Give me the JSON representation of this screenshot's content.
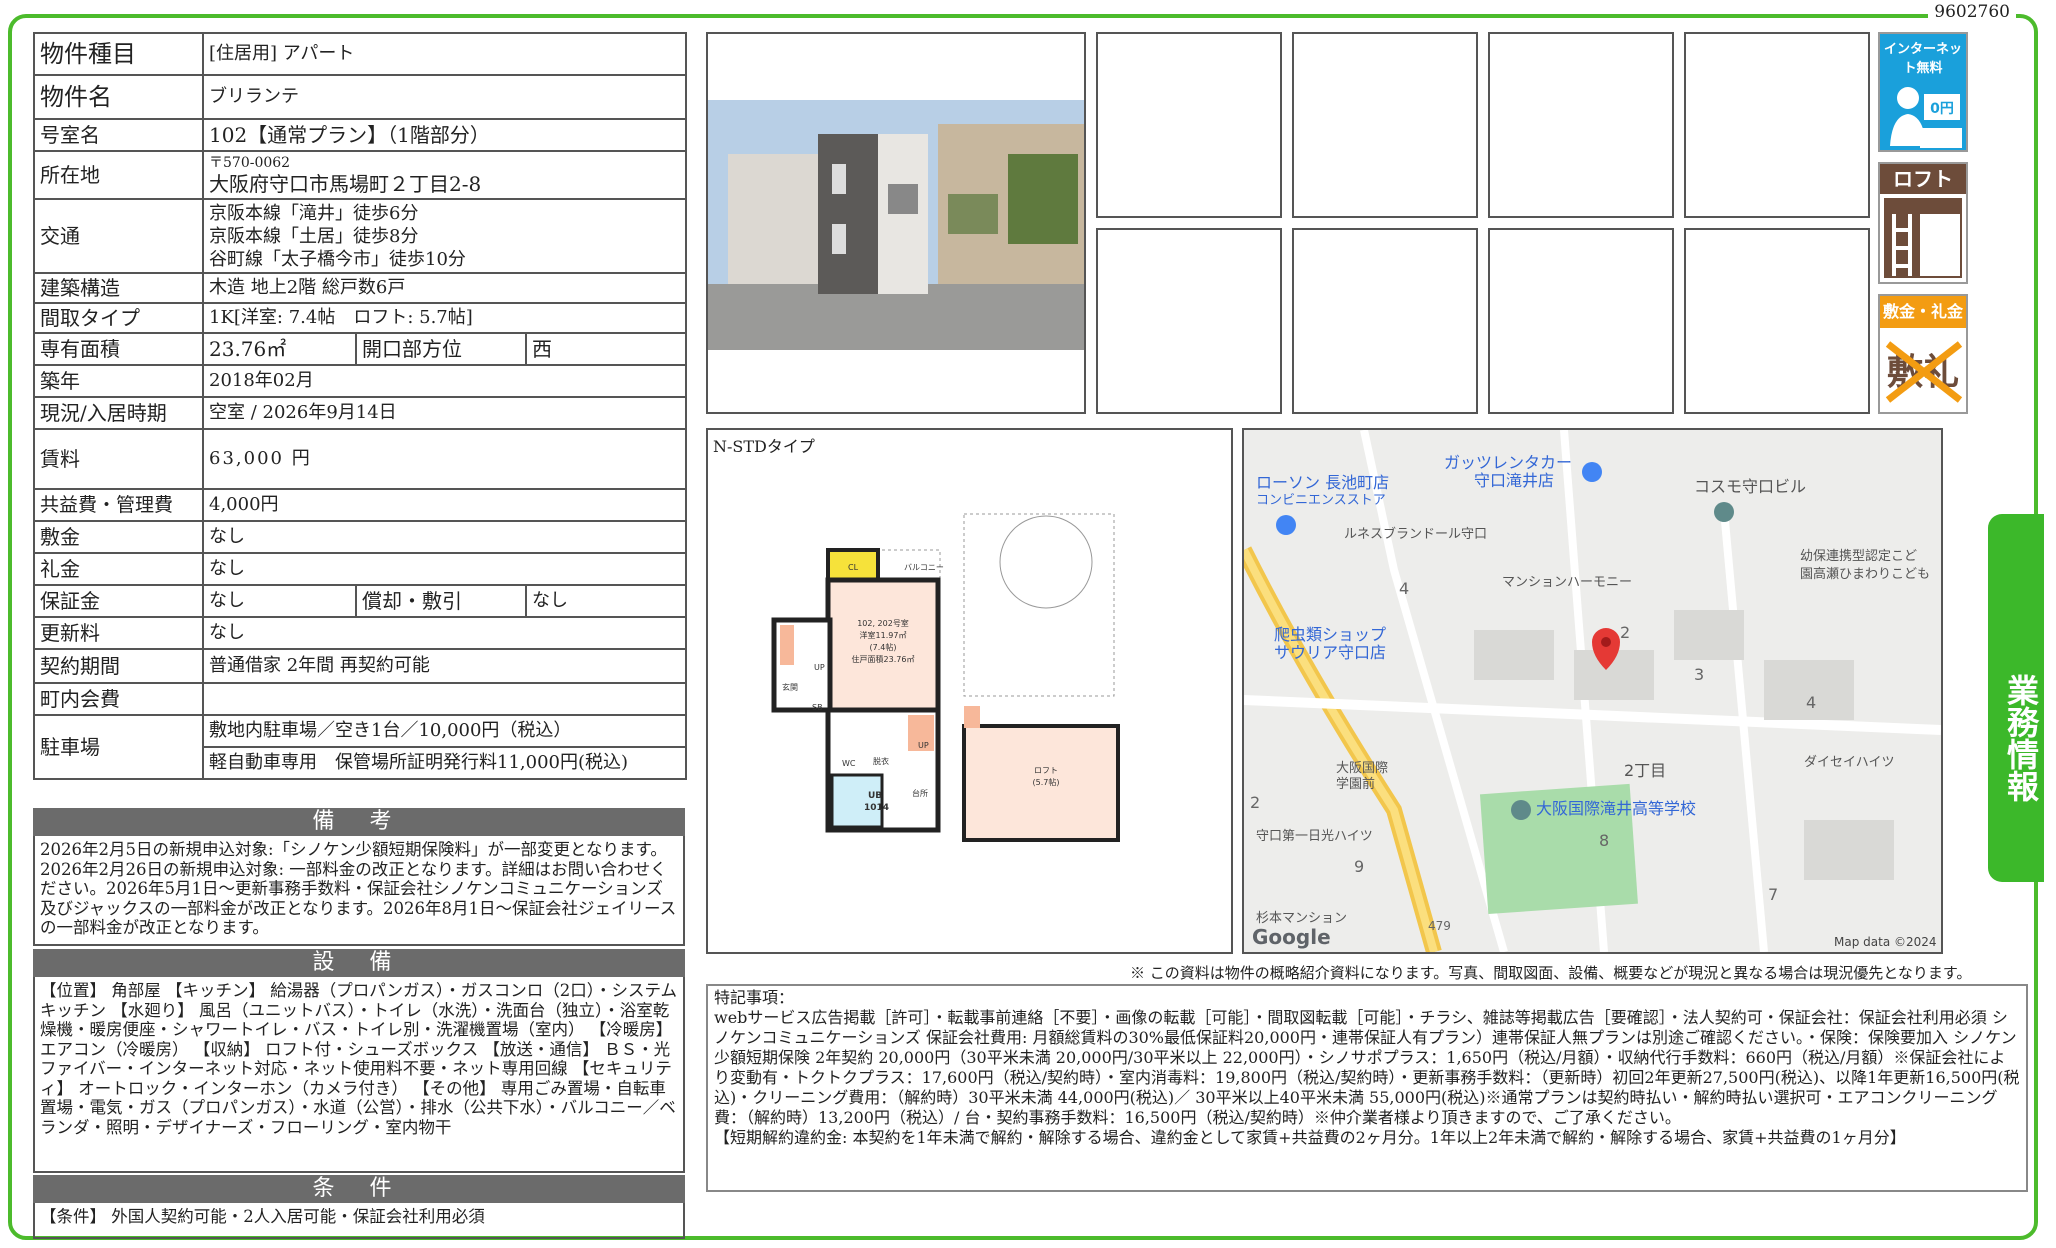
{
  "doc_id": "9602760",
  "property": {
    "type_label": "物件種目",
    "type_value": "[住居用] アパート",
    "name_label": "物件名",
    "name_value": "ブリランテ",
    "room_label": "号室名",
    "room_value": "102【通常プラン】（1階部分）",
    "address_label": "所在地",
    "postal": "〒570-0062",
    "address": "大阪府守口市馬場町２丁目2-8",
    "access_label": "交通",
    "access": [
      "京阪本線「滝井」徒歩6分",
      "京阪本線「土居」徒歩8分",
      "谷町線「太子橋今市」徒歩10分"
    ],
    "structure_label": "建築構造",
    "structure_value": "木造 地上2階 総戸数6戸",
    "layout_label": "間取タイプ",
    "layout_value": "1K[洋室: 7.4帖　ロフト: 5.7帖]",
    "area_label": "専有面積",
    "area_value": "23.76㎡",
    "direction_label": "開口部方位",
    "direction_value": "西",
    "built_label": "築年",
    "built_value": "2018年02月",
    "status_label": "現況/入居時期",
    "status_value": "空室 / 2026年9月14日",
    "rent_label": "賃料",
    "rent_value": "63,000 円",
    "fee_label": "共益費・管理費",
    "fee_value": "4,000円",
    "deposit_label": "敷金",
    "deposit_value": "なし",
    "keymoney_label": "礼金",
    "keymoney_value": "なし",
    "guarantee_label": "保証金",
    "guarantee_value": "なし",
    "amort_label": "償却・敷引",
    "amort_value": "なし",
    "renewal_label": "更新料",
    "renewal_value": "なし",
    "contract_label": "契約期間",
    "contract_value": "普通借家 2年間 再契約可能",
    "assoc_label": "町内会費",
    "assoc_value": "",
    "parking_label": "駐車場",
    "parking_1": "敷地内駐車場／空き1台／10,000円（税込）",
    "parking_2": "軽自動車専用　保管場所証明発行料11,000円(税込)"
  },
  "remarks": {
    "title": "備 考",
    "text": "2026年2月5日の新規申込対象:「シノケン少額短期保険料」が一部変更となります。2026年2月26日の新規申込対象: 一部料金の改正となります。詳細はお問い合わせください。2026年5月1日～更新事務手数料・保証会社シノケンコミュニケーションズ及びジャックスの一部料金が改正となります。2026年8月1日～保証会社ジェイリースの一部料金が改正となります。"
  },
  "equipment": {
    "title": "設 備",
    "text": "【位置】 角部屋 【キッチン】 給湯器（プロパンガス）・ガスコンロ（2口）・システムキッチン 【水廻り】 風呂（ユニットバス）・トイレ（水洗）・洗面台（独立）・浴室乾燥機・暖房便座・シャワートイレ・バス・トイレ別・洗濯機置場（室内） 【冷暖房】 エアコン（冷暖房） 【収納】 ロフト付・シューズボックス 【放送・通信】 ＢＳ・光ファイバー・インターネット対応・ネット使用料不要・ネット専用回線 【セキュリティ】 オートロック・インターホン（カメラ付き） 【その他】 専用ごみ置場・自転車置場・電気・ガス（プロパンガス）・水道（公営）・排水（公共下水）・バルコニー／ベランダ・照明・デザイナーズ・フローリング・室内物干"
  },
  "conditions": {
    "title": "条 件",
    "text": "【条件】 外国人契約可能・2人入居可能・保証会社利用必須"
  },
  "badges": {
    "internet": "インターネット無料",
    "internet_price": "0円",
    "loft": "ロフト",
    "zero": "敷金・礼金ゼロ",
    "zero_mark": "敷礼"
  },
  "floorplan": {
    "title": "N-STDタイプ",
    "balcony": "バルコニー",
    "cl": "CL",
    "room": "102, 202号室",
    "western": "洋室11.97㎡",
    "tatami": "(7.4帖)",
    "total": "住戸面積23.76㎡",
    "entrance": "玄関",
    "sb": "SB",
    "up1": "UP",
    "up2": "UP",
    "wc": "WC",
    "dressing": "脱衣",
    "ub": "UB",
    "ub_size": "1014",
    "kitchen": "台所",
    "loft": "ロフト",
    "loft_size": "(5.7帖)"
  },
  "map": {
    "labels": [
      "ローソン 長池町店",
      "コンビニエンスストア",
      "ガッツレンタカー",
      "守口滝井店",
      "コスモ守口ビル",
      "ルネスブランドール守口",
      "マンションハーモニー",
      "幼保連携型認定こど",
      "園高瀬ひまわりこども",
      "爬虫類ショップ",
      "サウリア守口店",
      "大阪国際",
      "学園前",
      "2丁目",
      "ダイセイハイツ",
      "大阪国際滝井高等学校",
      "守口第一日光ハイツ",
      "杉本マンション"
    ],
    "numbers": [
      "4",
      "2",
      "3",
      "4",
      "8",
      "9",
      "7",
      "2",
      "479"
    ],
    "brand": "Google",
    "credit": "Map data ©2024"
  },
  "note": "※ この資料は物件の概略紹介資料になります。写真、間取図面、設備、概要などが現況と異なる場合は現況優先となります。",
  "special": {
    "title": "特記事項：",
    "text": "webサービス広告掲載［許可］・転載事前連絡［不要］・画像の転載［可能］・間取図転載［可能］・チラシ、雑誌等掲載広告［要確認］・法人契約可・保証会社：保証会社利用必須 シノケンコミュニケーションズ 保証会社費用: 月額総賃料の30%最低保証料20,000円・連帯保証人有プラン）連帯保証人無プランは別途ご確認ください。・保険：保険要加入 シノケン少額短期保険 2年契約 20,000円（30平米未満 20,000円/30平米以上 22,000円）・シノサポプラス：1,650円（税込/月額）・収納代行手数料：660円（税込/月額）※保証会社により変動有・トクトクプラス：17,600円（税込/契約時）・室内消毒料：19,800円（税込/契約時）・更新事務手数料：（更新時）初回2年更新27,500円(税込)、以降1年更新16,500円(税込)・クリーニング費用：（解約時）30平米未満 44,000円(税込)／ 30平米以上40平米未満 55,000円(税込)※通常プランは契約時払い・解約時払い選択可・エアコンクリーニング費：（解約時）13,200円（税込）/ 台・契約事務手数料：16,500円（税込/契約時）※仲介業者様より頂きますので、ご了承ください。",
    "text2": "【短期解約違約金: 本契約を1年未満で解約・解除する場合、違約金として家賃+共益費の2ヶ月分。1年以上2年未満で解約・解除する場合、家賃+共益費の1ヶ月分】"
  },
  "side_tab": "業務情報"
}
